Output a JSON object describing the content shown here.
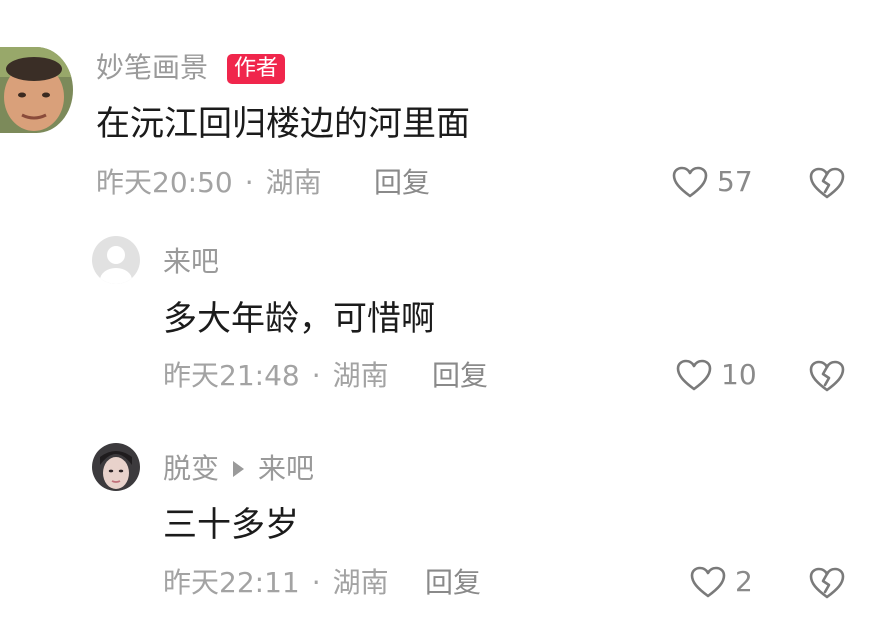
{
  "comments": [
    {
      "user": "妙笔画景",
      "badge": "作者",
      "text": "在沅江回归楼边的河里面",
      "time": "昨天20:50",
      "location": "湖南",
      "reply_label": "回复",
      "likes": "57"
    },
    {
      "user": "来吧",
      "text": "多大年龄，可惜啊",
      "time": "昨天21:48",
      "location": "湖南",
      "reply_label": "回复",
      "likes": "10"
    },
    {
      "user": "脱变",
      "reply_to": "来吧",
      "text": "三十多岁",
      "time": "昨天22:11",
      "location": "湖南",
      "reply_label": "回复",
      "likes": "2"
    }
  ],
  "meta_separator": "·",
  "icons": {
    "like": "heart-outline-icon",
    "dislike": "broken-heart-icon",
    "reply_arrow": "triangle-right-icon"
  },
  "colors": {
    "badge": "#f0264c",
    "name": "#9a9a9a",
    "text": "#1b1b1b",
    "meta": "#a3a3a3"
  }
}
